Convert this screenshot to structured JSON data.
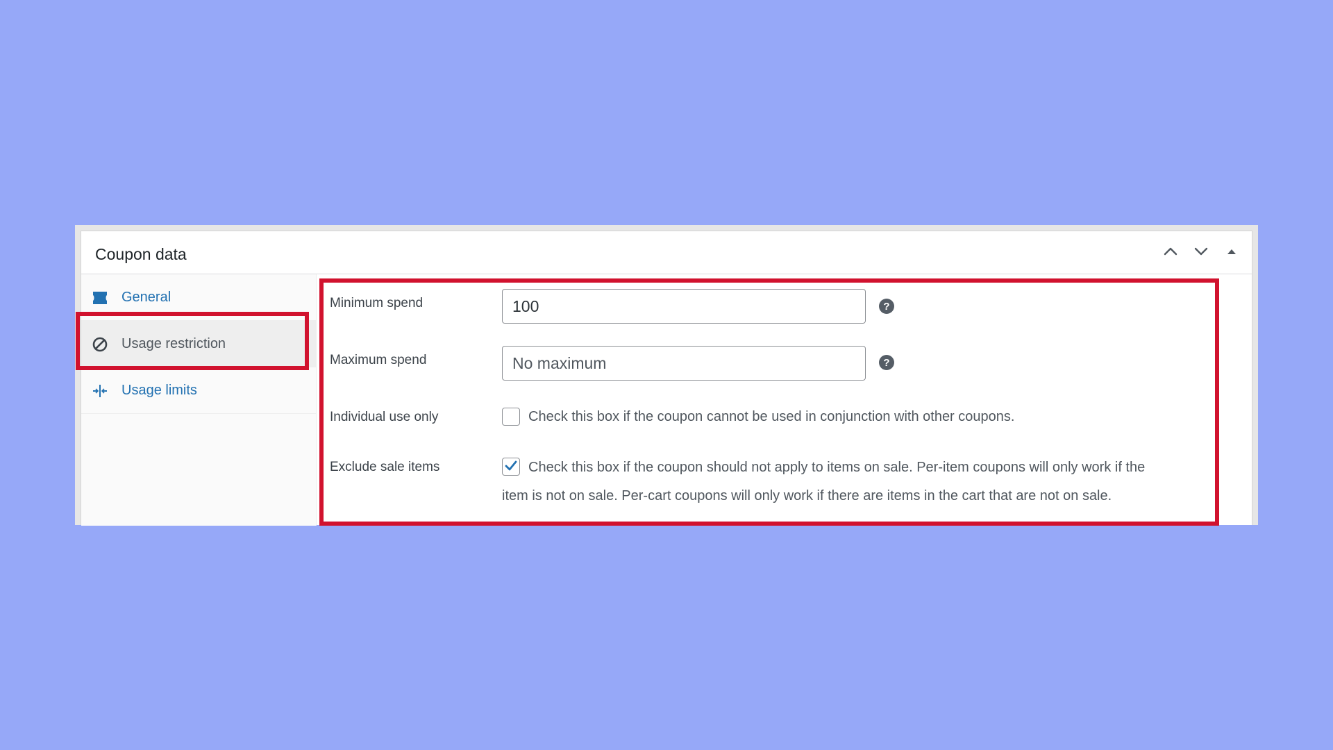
{
  "panel": {
    "title": "Coupon data"
  },
  "header_controls": {
    "move_up": "chevron-up-icon",
    "move_down": "chevron-down-icon",
    "toggle": "triangle-up-icon"
  },
  "sidebar": {
    "items": [
      {
        "label": "General",
        "icon": "ticket-icon",
        "active": false
      },
      {
        "label": "Usage restriction",
        "icon": "block-icon",
        "active": true
      },
      {
        "label": "Usage limits",
        "icon": "limits-icon",
        "active": false
      }
    ]
  },
  "form": {
    "minimum_spend": {
      "label": "Minimum spend",
      "value": "100"
    },
    "maximum_spend": {
      "label": "Maximum spend",
      "placeholder": "No maximum"
    },
    "individual_use": {
      "label": "Individual use only",
      "checked": false,
      "description": "Check this box if the coupon cannot be used in conjunction with other coupons."
    },
    "exclude_sale": {
      "label": "Exclude sale items",
      "checked": true,
      "description_line1": "Check this box if the coupon should not apply to items on sale. Per-item coupons will only work if the",
      "description_line2": "item is not on sale. Per-cart coupons will only work if there are items in the cart that are not on sale."
    }
  },
  "colors": {
    "background": "#96a8f8",
    "highlight": "#d1122e",
    "link": "#2271b1",
    "checkbox_check": "#2271b1"
  }
}
